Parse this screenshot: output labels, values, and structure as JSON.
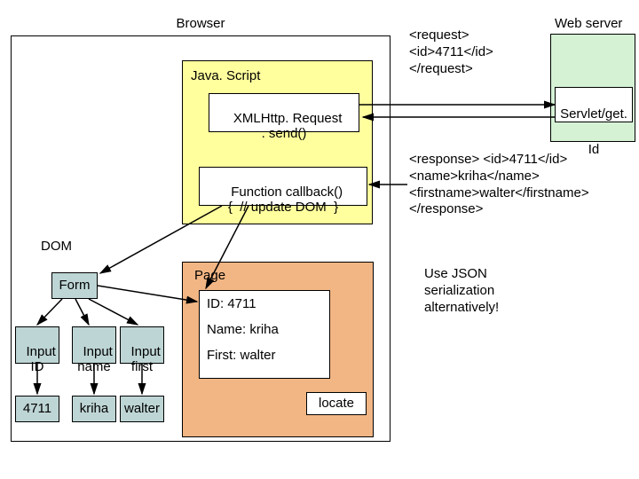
{
  "titles": {
    "browser": "Browser",
    "webserver": "Web server",
    "js": "Java. Script",
    "dom": "DOM",
    "page": "Page"
  },
  "js_boxes": {
    "xhr": "XMLHttp. Request\n. send()",
    "callback": "Function callback()\n{  // update DOM  }"
  },
  "server": {
    "servlet": "Servlet/get. Id"
  },
  "request": "<request>\n<id>4711</id>\n</request>",
  "response": "<response> <id>4711</id>\n<name>kriha</name>\n<firstname>walter</firstname>\n</response>",
  "json_note": "Use JSON\nserialization\nalternatively!",
  "form": "Form",
  "inputs": {
    "id": "Input\nID",
    "name": "Input\nname",
    "first": "Input\nfirst"
  },
  "values": {
    "id": "4711",
    "name": "kriha",
    "first": "walter"
  },
  "page_fields": {
    "id": "ID:  4711",
    "name": "Name: kriha",
    "first": "First: walter"
  },
  "button": "locate"
}
